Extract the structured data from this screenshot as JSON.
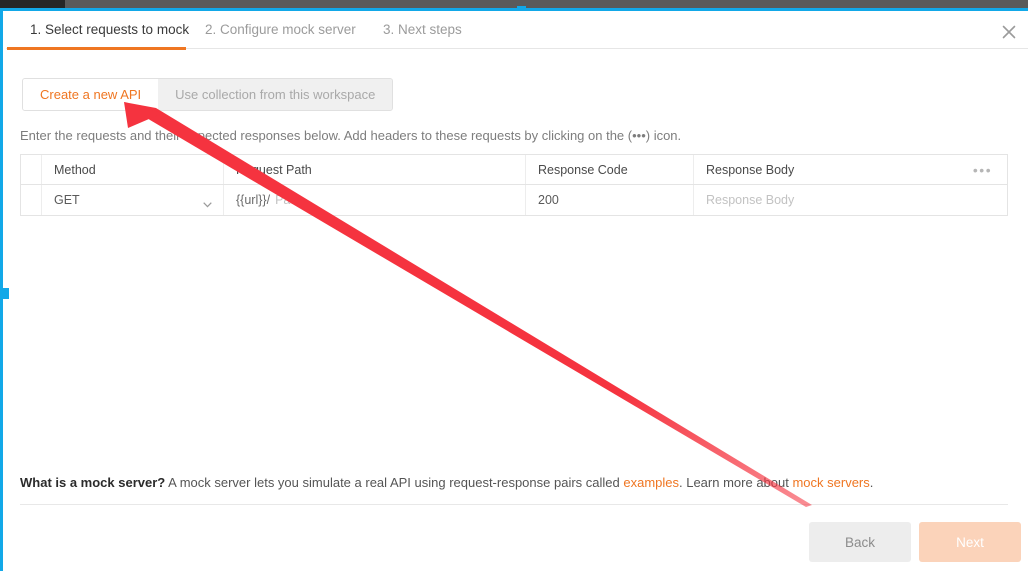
{
  "window": {
    "close_icon": "close-icon"
  },
  "tabs": [
    {
      "label": "1. Select requests to mock",
      "active": true
    },
    {
      "label": "2. Configure mock server",
      "active": false
    },
    {
      "label": "3. Next steps",
      "active": false
    }
  ],
  "source_toggle": {
    "options": [
      {
        "label": "Create a new API",
        "active": true
      },
      {
        "label": "Use collection from this workspace",
        "active": false
      }
    ]
  },
  "description": "Enter the requests and their expected responses below. Add headers to these requests by clicking on the (•••) icon.",
  "table": {
    "columns": [
      "Method",
      "Request Path",
      "Response Code",
      "Response Body"
    ],
    "actions_icon": "ellipsis-icon",
    "rows": [
      {
        "method": "GET",
        "method_caret": "chevron-down-icon",
        "path_prefix": "{{url}}/",
        "path_placeholder": "Path",
        "response_code": "200",
        "response_body_placeholder": "Response Body"
      }
    ]
  },
  "info": {
    "lead": "What is a mock server?",
    "text_1": " A mock server lets you simulate a real API using request-response pairs called ",
    "link_1": "examples",
    "text_2": ". Learn more about ",
    "link_2": "mock servers",
    "text_3": "."
  },
  "footer": {
    "back_label": "Back",
    "next_label": "Next"
  },
  "annotation": {
    "arrow_color": "#f5333f",
    "arrow_tip": "124,102",
    "arrow_tail": "812,505"
  },
  "colors": {
    "accent_orange": "#ef7622",
    "accent_blue": "#12a8e8",
    "next_disabled": "#fbd3ba"
  }
}
